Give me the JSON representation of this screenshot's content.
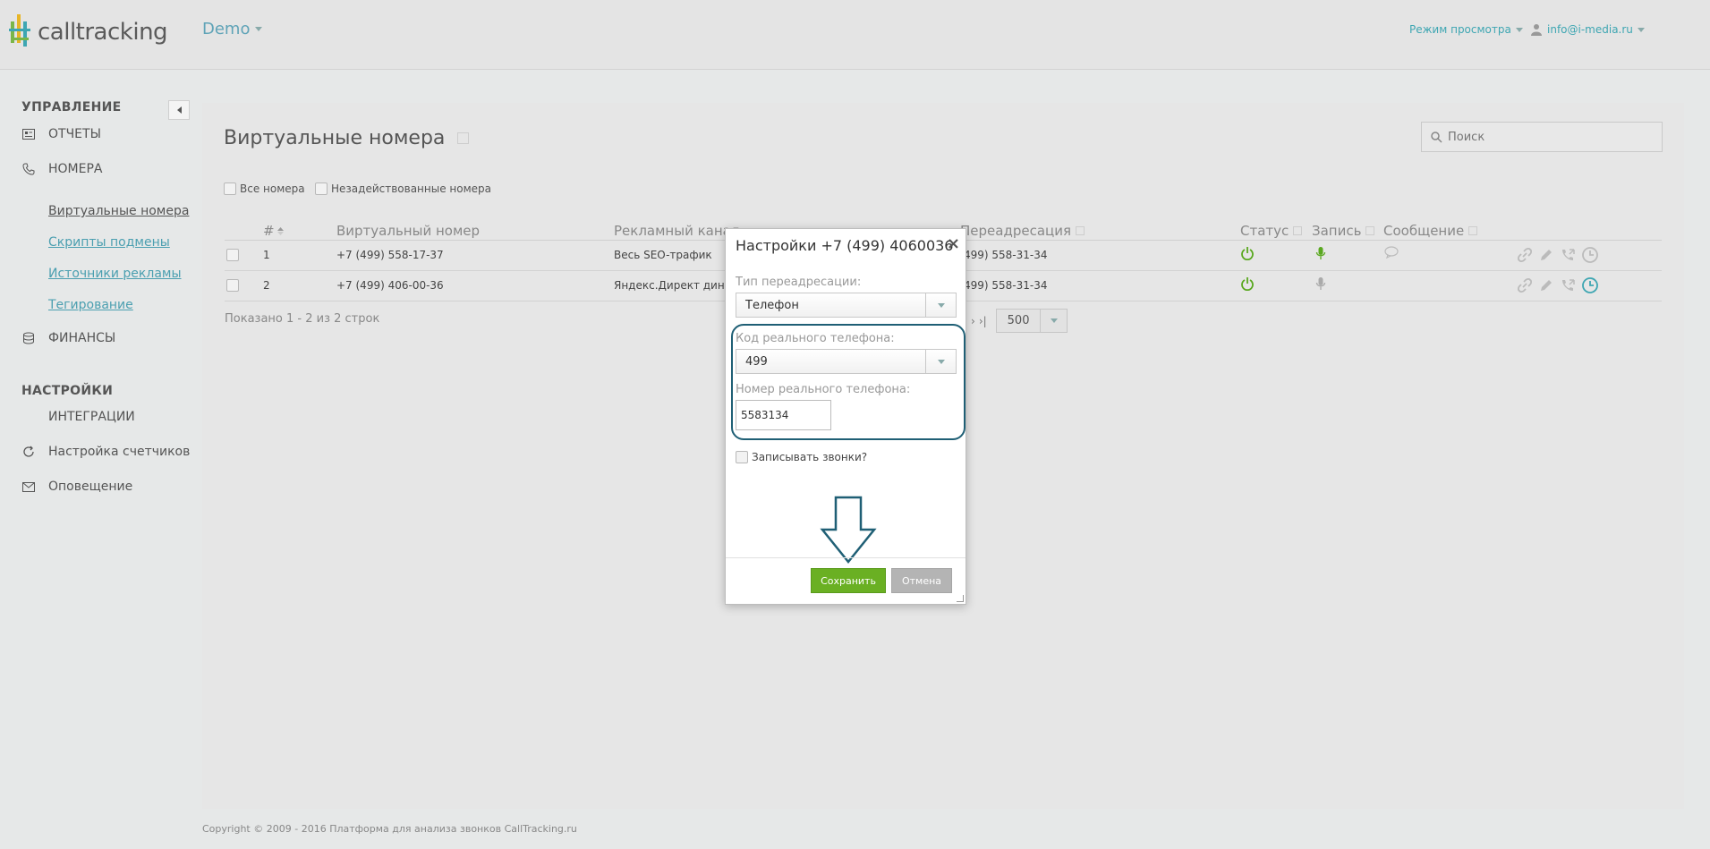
{
  "header": {
    "logo_text": "calltracking",
    "project": "Demo",
    "view_mode": "Режим просмотра",
    "user_email": "info@i-media.ru"
  },
  "sidebar": {
    "section_manage": "УПРАВЛЕНИЕ",
    "reports": "ОТЧЕТЫ",
    "numbers": "НОМЕРА",
    "sub": [
      "Виртуальные номера",
      "Скрипты подмены",
      "Источники рекламы",
      "Тегирование"
    ],
    "finance": "ФИНАНСЫ",
    "section_settings": "НАСТРОЙКИ",
    "integrations": "ИНТЕГРАЦИИ",
    "counters": "Настройка счетчиков",
    "notify": "Оповещение"
  },
  "page": {
    "title": "Виртуальные номера",
    "search_placeholder": "Поиск",
    "filter_all": "Все номера",
    "filter_unused": "Незадействованные номера"
  },
  "table": {
    "headers": {
      "num": "#",
      "virtual": "Виртуальный номер",
      "channel": "Рекламный канал",
      "redirect": "Переадресация",
      "status": "Статус",
      "record": "Запись",
      "message": "Сообщение"
    },
    "rows": [
      {
        "num": "1",
        "virtual": "+7 (499) 558-17-37",
        "channel": "Весь SEO-трафик",
        "redirect": "499) 558-31-34"
      },
      {
        "num": "2",
        "virtual": "+7 (499) 406-00-36",
        "channel": "Яндекс.Директ динам",
        "redirect": "499) 558-31-34"
      }
    ],
    "shown": "Показано 1 - 2 из 2 строк",
    "per_page": "500"
  },
  "footer": "Copyright © 2009 - 2016 Платформа для анализа звонков CallTracking.ru",
  "modal": {
    "title": "Настройки +7 (499) 4060036",
    "redirect_type_label": "Тип переадресации:",
    "redirect_type_value": "Телефон",
    "code_label": "Код реального телефона:",
    "code_value": "499",
    "number_label": "Номер реального телефона:",
    "number_value": "5583134",
    "record_label": "Записывать звонки?",
    "save": "Сохранить",
    "cancel": "Отмена"
  },
  "colors": {
    "accent": "#3ea6b2",
    "save_green": "#6ab023",
    "highlight": "#1f5f75"
  }
}
